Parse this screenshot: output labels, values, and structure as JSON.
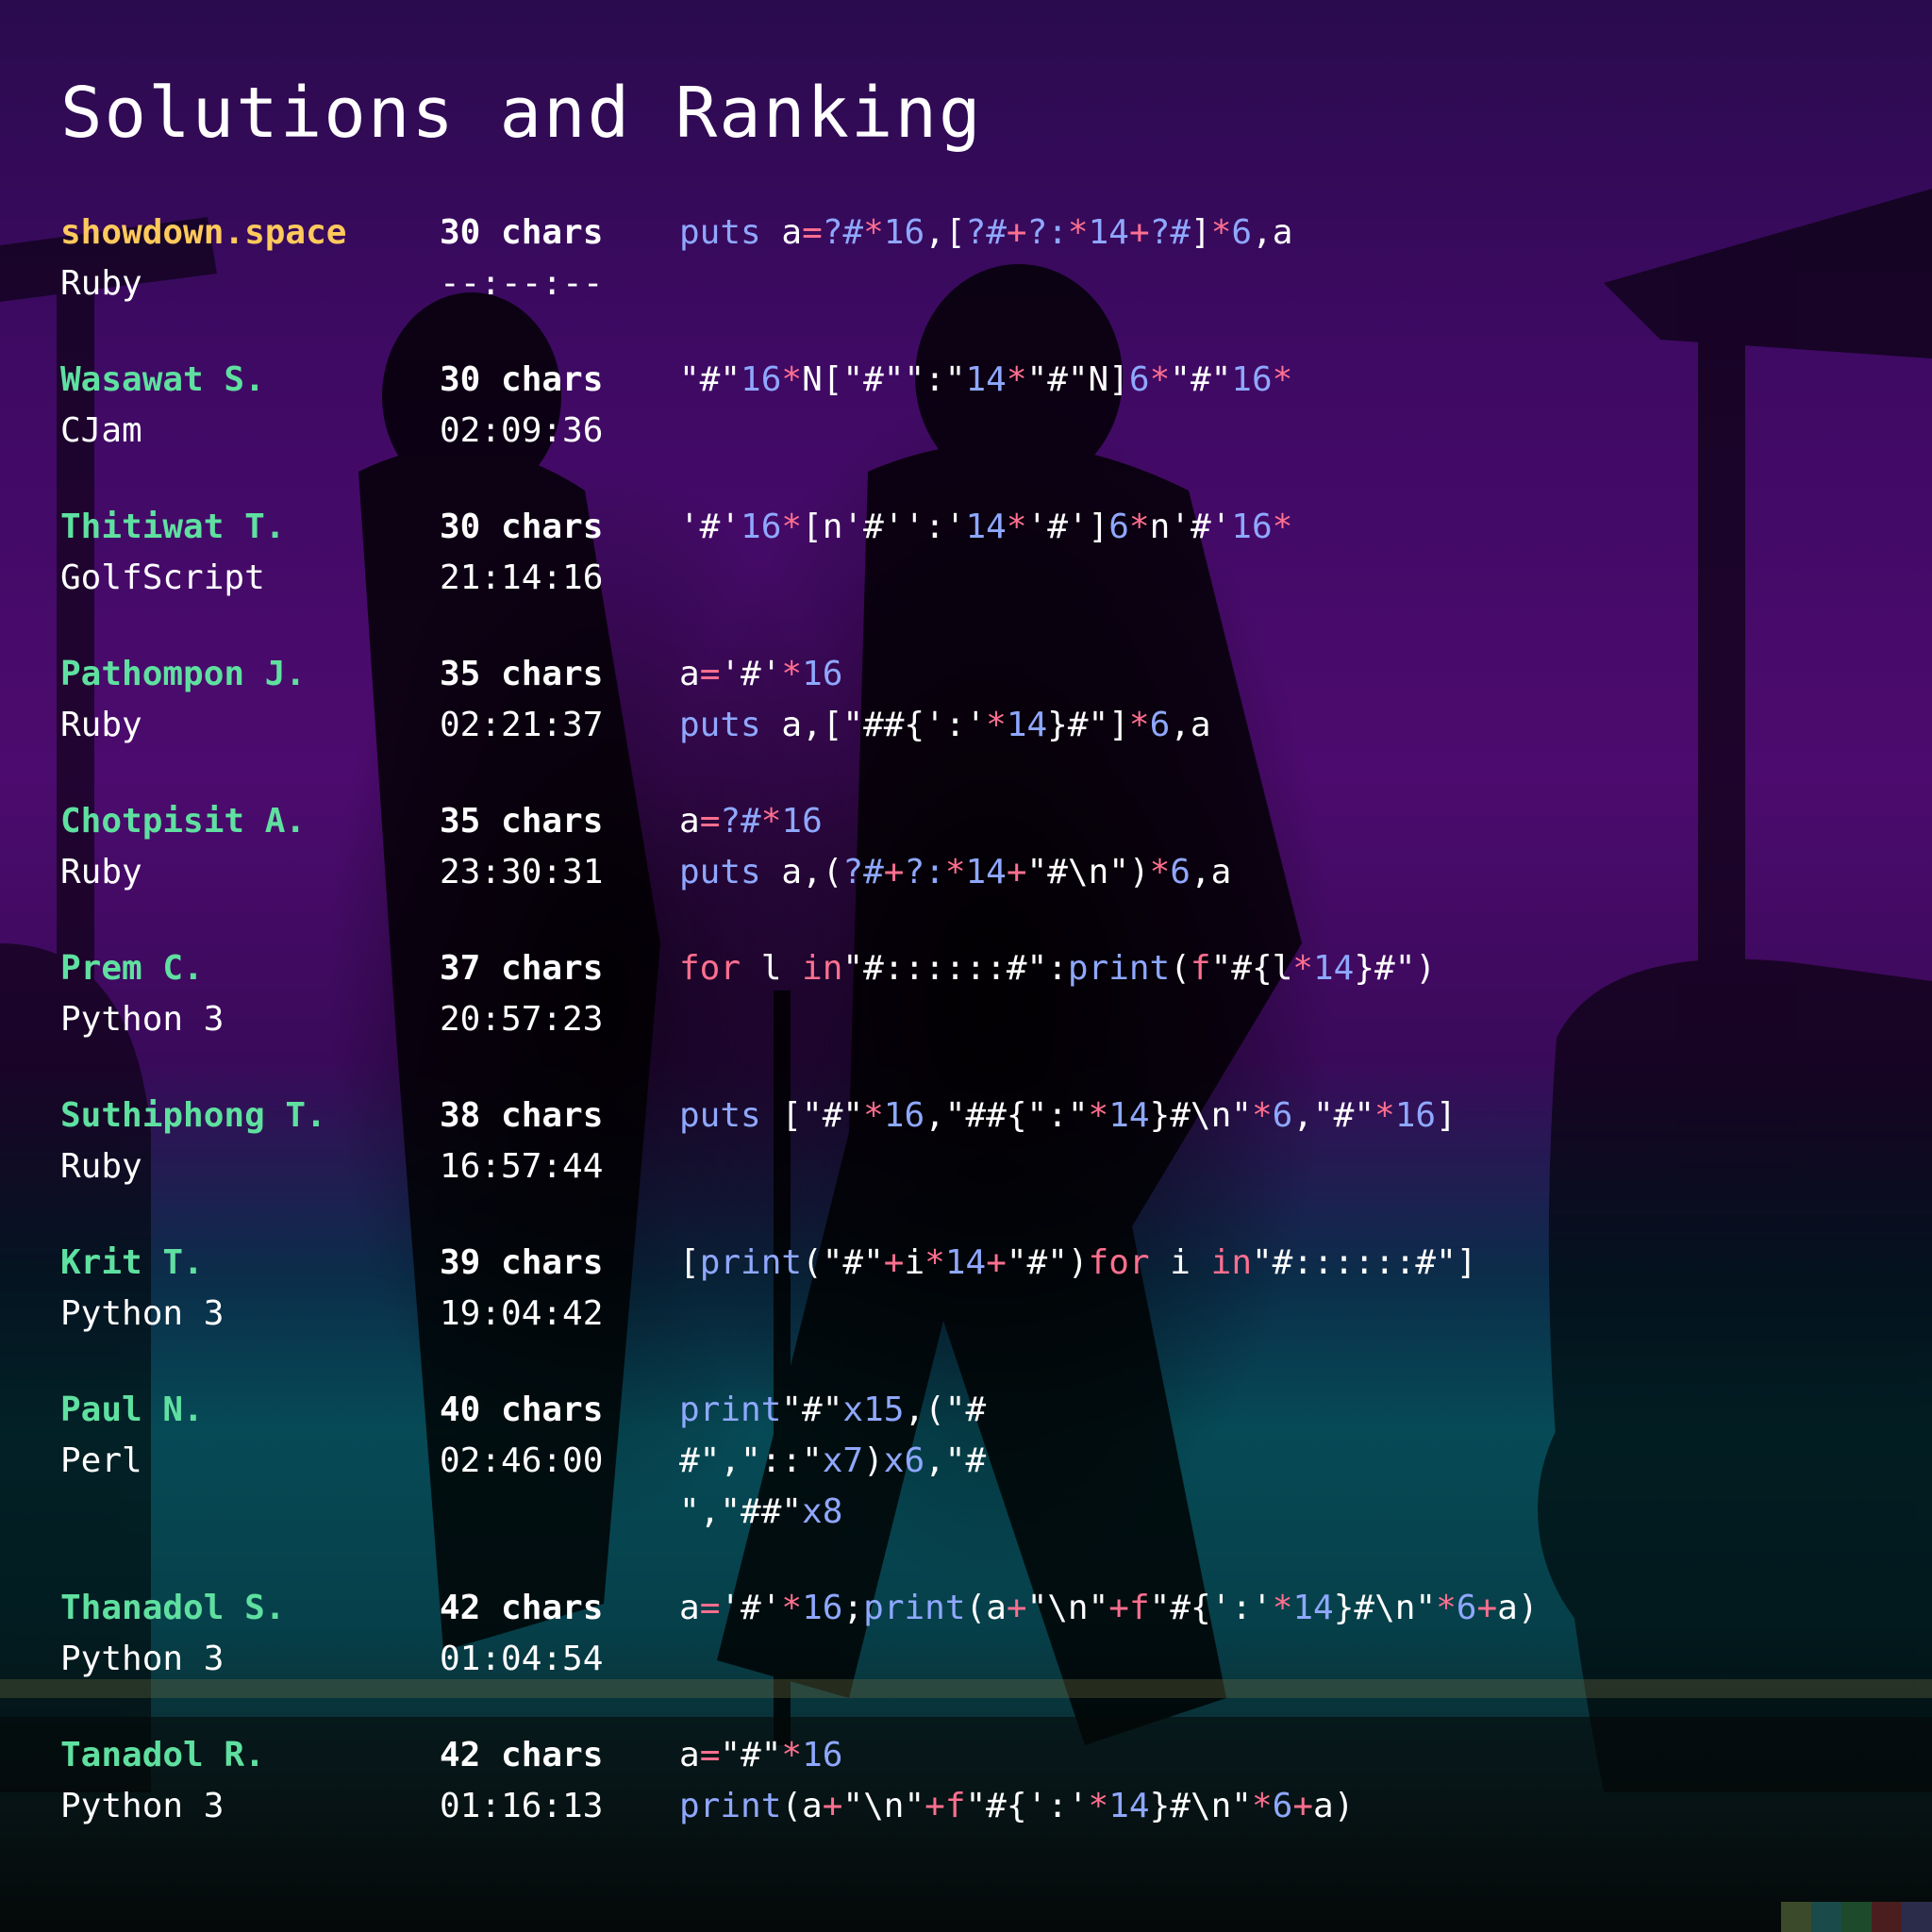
{
  "title": "Solutions and Ranking",
  "entries": [
    {
      "name": "showdown.space",
      "language": "Ruby",
      "chars": "30 chars",
      "time": "--:--:--",
      "highlight": true,
      "code": [
        [
          [
            "k",
            "puts "
          ],
          [
            "s",
            "a"
          ],
          [
            "o",
            "="
          ],
          [
            "k",
            "?#"
          ],
          [
            "o",
            "*"
          ],
          [
            "n",
            "16"
          ],
          [
            "s",
            ",["
          ],
          [
            "k",
            "?#"
          ],
          [
            "o",
            "+"
          ],
          [
            "k",
            "?:"
          ],
          [
            "o",
            "*"
          ],
          [
            "n",
            "14"
          ],
          [
            "o",
            "+"
          ],
          [
            "k",
            "?#"
          ],
          [
            "s",
            "]"
          ],
          [
            "o",
            "*"
          ],
          [
            "n",
            "6"
          ],
          [
            "s",
            ",a"
          ]
        ]
      ]
    },
    {
      "name": "Wasawat S.",
      "language": "CJam",
      "chars": "30 chars",
      "time": "02:09:36",
      "code": [
        [
          [
            "s",
            "\"#\""
          ],
          [
            "n",
            "16"
          ],
          [
            "o",
            "*"
          ],
          [
            "s",
            "N[\"#\"\":\""
          ],
          [
            "n",
            "14"
          ],
          [
            "o",
            "*"
          ],
          [
            "s",
            "\"#\"N]"
          ],
          [
            "n",
            "6"
          ],
          [
            "o",
            "*"
          ],
          [
            "s",
            "\"#\""
          ],
          [
            "n",
            "16"
          ],
          [
            "o",
            "*"
          ]
        ]
      ]
    },
    {
      "name": "Thitiwat T.",
      "language": "GolfScript",
      "chars": "30 chars",
      "time": "21:14:16",
      "code": [
        [
          [
            "s",
            "'#'"
          ],
          [
            "n",
            "16"
          ],
          [
            "o",
            "*"
          ],
          [
            "s",
            "[n'#'':'"
          ],
          [
            "n",
            "14"
          ],
          [
            "o",
            "*"
          ],
          [
            "s",
            "'#']"
          ],
          [
            "n",
            "6"
          ],
          [
            "o",
            "*"
          ],
          [
            "s",
            "n'#'"
          ],
          [
            "n",
            "16"
          ],
          [
            "o",
            "*"
          ]
        ]
      ]
    },
    {
      "name": "Pathompon J.",
      "language": "Ruby",
      "chars": "35 chars",
      "time": "02:21:37",
      "code": [
        [
          [
            "s",
            "a"
          ],
          [
            "o",
            "="
          ],
          [
            "s",
            "'#'"
          ],
          [
            "o",
            "*"
          ],
          [
            "n",
            "16"
          ]
        ],
        [
          [
            "k",
            "puts "
          ],
          [
            "s",
            "a,[\"##{':'"
          ],
          [
            "o",
            "*"
          ],
          [
            "n",
            "14"
          ],
          [
            "s",
            "}#\"]"
          ],
          [
            "o",
            "*"
          ],
          [
            "n",
            "6"
          ],
          [
            "s",
            ",a"
          ]
        ]
      ]
    },
    {
      "name": "Chotpisit A.",
      "language": "Ruby",
      "chars": "35 chars",
      "time": "23:30:31",
      "code": [
        [
          [
            "s",
            "a"
          ],
          [
            "o",
            "="
          ],
          [
            "k",
            "?#"
          ],
          [
            "o",
            "*"
          ],
          [
            "n",
            "16"
          ]
        ],
        [
          [
            "k",
            "puts "
          ],
          [
            "s",
            "a,("
          ],
          [
            "k",
            "?#"
          ],
          [
            "o",
            "+"
          ],
          [
            "k",
            "?:"
          ],
          [
            "o",
            "*"
          ],
          [
            "n",
            "14"
          ],
          [
            "o",
            "+"
          ],
          [
            "s",
            "\"#\\n\")"
          ],
          [
            "o",
            "*"
          ],
          [
            "n",
            "6"
          ],
          [
            "s",
            ",a"
          ]
        ]
      ]
    },
    {
      "name": "Prem C.",
      "language": "Python 3",
      "chars": "37 chars",
      "time": "20:57:23",
      "code": [
        [
          [
            "r",
            "for "
          ],
          [
            "s",
            "l "
          ],
          [
            "r",
            "in"
          ],
          [
            "s",
            "\"#::::::#\":"
          ],
          [
            "k",
            "print"
          ],
          [
            "s",
            "("
          ],
          [
            "r",
            "f"
          ],
          [
            "s",
            "\"#{l"
          ],
          [
            "o",
            "*"
          ],
          [
            "n",
            "14"
          ],
          [
            "s",
            "}#\")"
          ]
        ]
      ]
    },
    {
      "name": "Suthiphong T.",
      "language": "Ruby",
      "chars": "38 chars",
      "time": "16:57:44",
      "code": [
        [
          [
            "k",
            "puts "
          ],
          [
            "s",
            "[\"#\""
          ],
          [
            "o",
            "*"
          ],
          [
            "n",
            "16"
          ],
          [
            "s",
            ",\"##{\":\""
          ],
          [
            "o",
            "*"
          ],
          [
            "n",
            "14"
          ],
          [
            "s",
            "}#\\n\""
          ],
          [
            "o",
            "*"
          ],
          [
            "n",
            "6"
          ],
          [
            "s",
            ",\"#\""
          ],
          [
            "o",
            "*"
          ],
          [
            "n",
            "16"
          ],
          [
            "s",
            "]"
          ]
        ]
      ]
    },
    {
      "name": "Krit T.",
      "language": "Python 3",
      "chars": "39 chars",
      "time": "19:04:42",
      "code": [
        [
          [
            "s",
            "["
          ],
          [
            "k",
            "print"
          ],
          [
            "s",
            "(\"#\""
          ],
          [
            "o",
            "+"
          ],
          [
            "s",
            "i"
          ],
          [
            "o",
            "*"
          ],
          [
            "n",
            "14"
          ],
          [
            "o",
            "+"
          ],
          [
            "s",
            "\"#\")"
          ],
          [
            "r",
            "for "
          ],
          [
            "s",
            "i "
          ],
          [
            "r",
            "in"
          ],
          [
            "s",
            "\"#::::::#\"]"
          ]
        ]
      ]
    },
    {
      "name": "Paul N.",
      "language": "Perl",
      "chars": "40 chars",
      "time": "02:46:00",
      "code": [
        [
          [
            "k",
            "print"
          ],
          [
            "s",
            "\"#\""
          ],
          [
            "k",
            "x15"
          ],
          [
            "s",
            ",(\"#"
          ]
        ],
        [
          [
            "s",
            "#\",\"::\""
          ],
          [
            "k",
            "x7"
          ],
          [
            "s",
            ")"
          ],
          [
            "k",
            "x6"
          ],
          [
            "s",
            ",\"#"
          ]
        ],
        [
          [
            "s",
            "\",\"##\""
          ],
          [
            "k",
            "x8"
          ]
        ]
      ]
    },
    {
      "name": "Thanadol S.",
      "language": "Python 3",
      "chars": "42 chars",
      "time": "01:04:54",
      "code": [
        [
          [
            "s",
            "a"
          ],
          [
            "o",
            "="
          ],
          [
            "s",
            "'#'"
          ],
          [
            "o",
            "*"
          ],
          [
            "n",
            "16"
          ],
          [
            "s",
            ";"
          ],
          [
            "k",
            "print"
          ],
          [
            "s",
            "(a"
          ],
          [
            "o",
            "+"
          ],
          [
            "s",
            "\"\\n\""
          ],
          [
            "o",
            "+"
          ],
          [
            "r",
            "f"
          ],
          [
            "s",
            "\"#{':'"
          ],
          [
            "o",
            "*"
          ],
          [
            "n",
            "14"
          ],
          [
            "s",
            "}#\\n\""
          ],
          [
            "o",
            "*"
          ],
          [
            "n",
            "6"
          ],
          [
            "o",
            "+"
          ],
          [
            "s",
            "a)"
          ]
        ]
      ]
    },
    {
      "name": "Tanadol R.",
      "language": "Python 3",
      "chars": "42 chars",
      "time": "01:16:13",
      "code": [
        [
          [
            "s",
            "a"
          ],
          [
            "o",
            "="
          ],
          [
            "s",
            "\"#\""
          ],
          [
            "o",
            "*"
          ],
          [
            "n",
            "16"
          ]
        ],
        [
          [
            "k",
            "print"
          ],
          [
            "s",
            "(a"
          ],
          [
            "o",
            "+"
          ],
          [
            "s",
            "\"\\n\""
          ],
          [
            "o",
            "+"
          ],
          [
            "r",
            "f"
          ],
          [
            "s",
            "\"#{':'"
          ],
          [
            "o",
            "*"
          ],
          [
            "n",
            "14"
          ],
          [
            "s",
            "}#\\n\""
          ],
          [
            "o",
            "*"
          ],
          [
            "n",
            "6"
          ],
          [
            "o",
            "+"
          ],
          [
            "s",
            "a)"
          ]
        ]
      ]
    }
  ],
  "swatches": [
    "#3a4a2a",
    "#1a4a4a",
    "#1d4a2a",
    "#4a1e1e",
    "#2b2b4a"
  ]
}
